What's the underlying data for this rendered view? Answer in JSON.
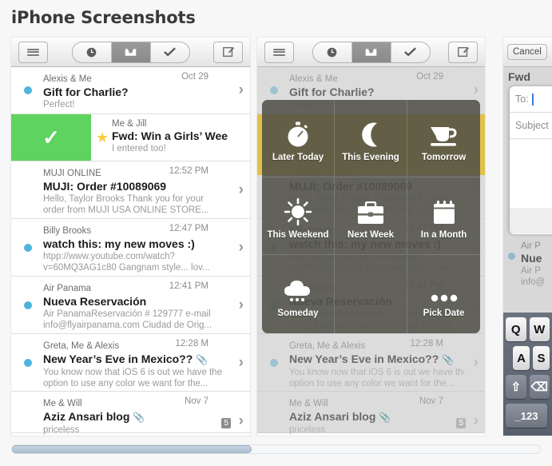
{
  "page": {
    "title": "iPhone Screenshots"
  },
  "toolbar": {
    "menu_icon": "hamburger-icon",
    "segments": [
      {
        "icon": "clock-icon",
        "active": false
      },
      {
        "icon": "inbox-icon",
        "active": true
      },
      {
        "icon": "check-icon",
        "active": false
      }
    ],
    "compose_icon": "compose-icon"
  },
  "inbox": {
    "rows": [
      {
        "from": "Alexis & Me",
        "time": "Oct 29",
        "subject": "Gift for Charlie?",
        "preview": "Perfect!",
        "unread": true,
        "attachment": false
      },
      {
        "from": "Me & Jill",
        "time": "",
        "subject": "Fwd: Win a Girls’ Wee",
        "preview": "I entered too!",
        "unread": false,
        "attachment": false,
        "starred": true,
        "swiped": true,
        "swipe_icon": "check-icon"
      },
      {
        "from": "MUJI ONLINE",
        "time": "12:52 PM",
        "subject": "MUJI: Order #10089069",
        "preview": "Hello, Taylor Brooks Thank you for your",
        "preview2": "order from MUJI USA ONLINE STORE...",
        "unread": false,
        "attachment": false
      },
      {
        "from": "Billy Brooks",
        "time": "12:47 PM",
        "subject": "watch this: my new moves :)",
        "preview": "htpp://www.youtube.com/watch?",
        "preview2": "v=60MQ3AG1c80 Gangnam style... lov...",
        "unread": true,
        "attachment": false
      },
      {
        "from": "Air Panama",
        "time": "12:41 PM",
        "subject": "Nueva Reservación",
        "preview": "Air PanamaReservación # 129777 e-mail",
        "preview2": "info@flyairpanama.com Ciudad de Orig...",
        "unread": true,
        "attachment": false
      },
      {
        "from": "Greta, Me & Alexis",
        "time": "12:28 M",
        "subject": "New Year’s Eve in Mexico??",
        "preview": "You know now that iOS 6 is out we have the",
        "preview2": "option to use any color we want for the...",
        "unread": true,
        "attachment": true
      },
      {
        "from": "Me & Will",
        "time": "Nov 7",
        "subject": "Aziz Ansari blog",
        "preview": "priceless",
        "unread": false,
        "attachment": true,
        "badge": "5"
      }
    ]
  },
  "snooze": {
    "options": [
      {
        "label": "Later Today",
        "icon": "stopwatch-icon"
      },
      {
        "label": "This Evening",
        "icon": "moon-icon"
      },
      {
        "label": "Tomorrow",
        "icon": "coffee-cup-icon"
      },
      {
        "label": "This Weekend",
        "icon": "sun-icon"
      },
      {
        "label": "Next Week",
        "icon": "briefcase-icon"
      },
      {
        "label": "In a Month",
        "icon": "calendar-icon"
      },
      {
        "label": "Someday",
        "icon": "cloud-icon"
      },
      {
        "label": "",
        "icon": ""
      },
      {
        "label": "Pick Date",
        "icon": "ellipsis-icon"
      }
    ],
    "highlight_color": "#e0c24a",
    "overlay_color": "#4e4e46"
  },
  "compose": {
    "cancel_label": "Cancel",
    "ghost_subject": "Fwd",
    "to_label": "To:",
    "subject_placeholder": "Subject",
    "keys_row1": [
      "Q",
      "W"
    ],
    "keys_row2": [
      "A",
      "S"
    ],
    "shift_key": "shift-icon",
    "backspace_key": "backspace-icon",
    "numeric_key": "_123",
    "ghost_rows": [
      {
        "from": "Air P",
        "subject": "Nue",
        "preview": "Air P",
        "preview2": "info@"
      }
    ]
  },
  "colors": {
    "accent_blue": "#4fb3dd",
    "swipe_green": "#5fd35f",
    "star_yellow": "#f6cf3f",
    "scrollbar_thumb": "#aebfd2"
  }
}
